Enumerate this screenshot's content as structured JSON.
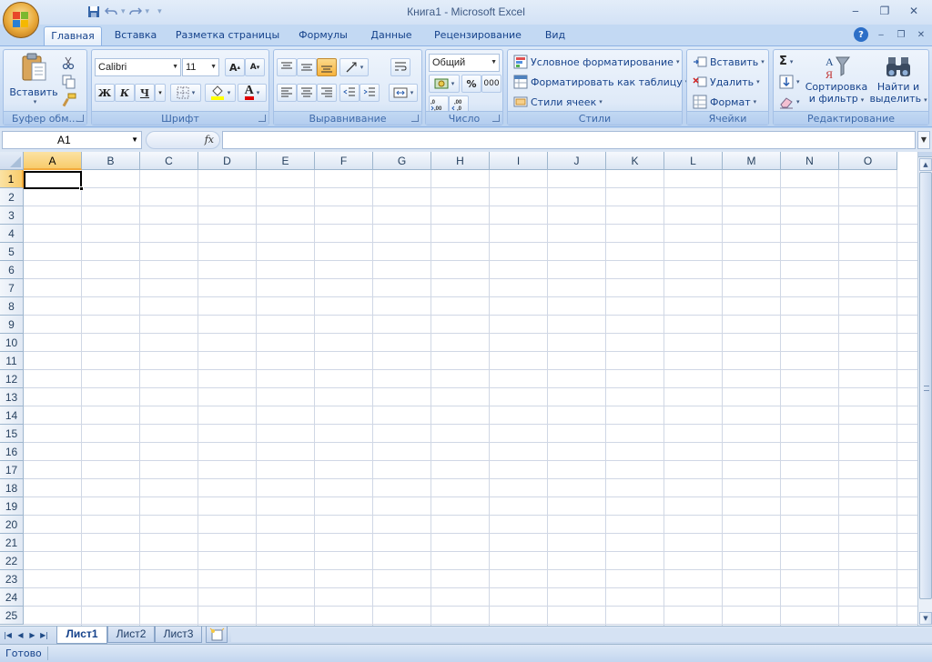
{
  "window": {
    "title": "Книга1 - Microsoft Excel",
    "controls": {
      "minimize": "‒",
      "restore": "❐",
      "close": "✕"
    }
  },
  "quick_access": {
    "save_icon": "save-icon",
    "undo_icon": "undo-icon",
    "redo_icon": "redo-icon"
  },
  "tabs": [
    {
      "label": "Главная",
      "active": true
    },
    {
      "label": "Вставка"
    },
    {
      "label": "Разметка страницы"
    },
    {
      "label": "Формулы"
    },
    {
      "label": "Данные"
    },
    {
      "label": "Рецензирование"
    },
    {
      "label": "Вид"
    }
  ],
  "ribbon": {
    "clipboard": {
      "label": "Буфер обм...",
      "paste": "Вставить"
    },
    "font": {
      "label": "Шрифт",
      "family": "Calibri",
      "size": "11",
      "grow": "A",
      "shrink": "A",
      "bold": "Ж",
      "italic": "К",
      "underline": "Ч",
      "font_color_glyph": "A"
    },
    "alignment": {
      "label": "Выравнивание"
    },
    "number": {
      "label": "Число",
      "format": "Общий",
      "percent": "%",
      "thousands": "000"
    },
    "styles": {
      "label": "Стили",
      "conditional": "Условное форматирование",
      "as_table": "Форматировать как таблицу",
      "cell_styles": "Стили ячеек"
    },
    "cells": {
      "label": "Ячейки",
      "insert": "Вставить",
      "delete": "Удалить",
      "format": "Формат"
    },
    "editing": {
      "label": "Редактирование",
      "sum": "Σ",
      "sort_line1": "Сортировка",
      "sort_line2": "и фильтр",
      "find_line1": "Найти и",
      "find_line2": "выделить"
    }
  },
  "formula_bar": {
    "name_box": "A1",
    "fx": "fx",
    "value": ""
  },
  "grid": {
    "columns": [
      "A",
      "B",
      "C",
      "D",
      "E",
      "F",
      "G",
      "H",
      "I",
      "J",
      "K",
      "L",
      "M",
      "N",
      "O"
    ],
    "rows": [
      "1",
      "2",
      "3",
      "4",
      "5",
      "6",
      "7",
      "8",
      "9",
      "10",
      "11",
      "12",
      "13",
      "14",
      "15",
      "16",
      "17",
      "18",
      "19",
      "20",
      "21",
      "22",
      "23",
      "24",
      "25"
    ],
    "selected_column": "A",
    "selected_row": "1"
  },
  "sheets": [
    {
      "label": "Лист1",
      "active": true
    },
    {
      "label": "Лист2"
    },
    {
      "label": "Лист3"
    }
  ],
  "status": {
    "text": "Готово"
  },
  "colors": {
    "accent": "#15428b",
    "ribbon": "#c7daf3",
    "selection": "#f8cc6b",
    "gridline": "#d0d7e5"
  }
}
